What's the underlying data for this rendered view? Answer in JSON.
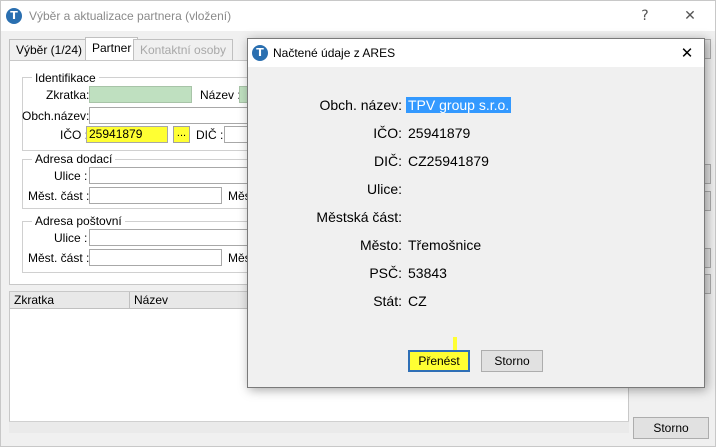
{
  "window": {
    "title": "Výběr a aktualizace partnera (vložení)",
    "help_label": "?",
    "close_label": "✕",
    "icon_letter": "T"
  },
  "tabs": [
    {
      "label": "Výběr (1/24)"
    },
    {
      "label": "Partner"
    },
    {
      "label": "Kontaktní osoby"
    }
  ],
  "form": {
    "identification_legend": "Identifikace",
    "zkratka_label": "Zkratka:",
    "nazev_label": "Název :",
    "obch_nazev_label": "Obch.název:",
    "ico_label": "IČO :",
    "ico_value": "25941879",
    "dots_label": "...",
    "dic_label": "DIČ :",
    "adresa_dodaci_legend": "Adresa dodací",
    "ulice_label": "Ulice :",
    "mest_cast_label": "Měst. část :",
    "mest_label_trunc": "Měs",
    "adresa_postovni_legend": "Adresa poštovní",
    "ulice2_label": "Ulice :",
    "mest_cast2_label": "Měst. část :",
    "mest2_label_trunc": "Měs"
  },
  "grid": {
    "columns": [
      "Zkratka",
      "Název"
    ]
  },
  "storno_main_label": "Storno",
  "dialog": {
    "icon_letter": "T",
    "title": "Načtené údaje z ARES",
    "close_label": "✕",
    "rows": [
      {
        "label": "Obch. název:",
        "value": "TPV group s.r.o."
      },
      {
        "label": "IČO:",
        "value": "25941879"
      },
      {
        "label": "DIČ:",
        "value": "CZ25941879"
      },
      {
        "label": "Ulice:",
        "value": ""
      },
      {
        "label": "Městská část:",
        "value": ""
      },
      {
        "label": "Město:",
        "value": "Třemošnice"
      },
      {
        "label": "PSČ:",
        "value": "53843"
      },
      {
        "label": "Stát:",
        "value": "CZ"
      }
    ],
    "transfer_label": "Přenést",
    "cancel_label": "Storno"
  }
}
